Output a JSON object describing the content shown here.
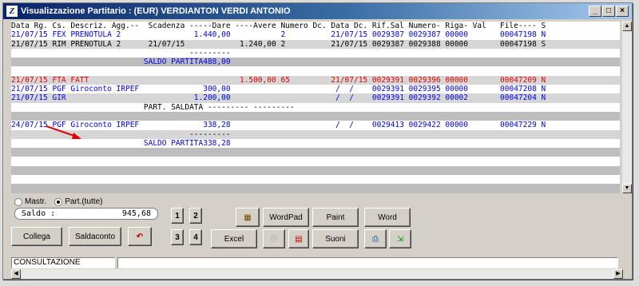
{
  "window": {
    "title": "Visualizzazione Partitario : (EUR) VERDIANTON VERDI ANTONIO",
    "app_icon": "Z",
    "minimize_label": "_",
    "maximize_label": "□",
    "close_label": "×"
  },
  "grid": {
    "header": "Data Rg. Cs. Descriz. Agg.--  Scadenza -----Dare ----Avere Numero Dc. Data Dc. Rif.Sal Numero- Riga- Val   File---- S",
    "rows": [
      {
        "style": "blue",
        "bg": "white",
        "date": "21/07/15",
        "cs": "FEX",
        "descr": "PRENOTULA 2",
        "scad": "",
        "dare": "1.440,00",
        "avere": "",
        "num": "2",
        "datadc": "21/07/15",
        "rifsal": "0029387",
        "numero": "0029387",
        "riga": "00000",
        "file": "00047198",
        "s": "N"
      },
      {
        "style": "black",
        "bg": "gray",
        "date": "21/07/15",
        "cs": "RIM",
        "descr": "PRENOTULA 2",
        "scad": "21/07/15",
        "dare": "",
        "avere": "1.240,00",
        "num": "2",
        "datadc": "21/07/15",
        "rifsal": "0029387",
        "numero": "0029388",
        "riga": "00000",
        "file": "00047198",
        "s": "S"
      },
      {
        "kind": "sep",
        "bg": "white",
        "text": "---------"
      },
      {
        "kind": "saldo",
        "bg": "darkgray",
        "label": "SALDO PARTITA",
        "value": "488,00"
      },
      {
        "kind": "empty",
        "bg": "white"
      },
      {
        "style": "red",
        "bg": "gray",
        "date": "21/07/15",
        "cs": "FTA",
        "descr": "FATT",
        "scad": "",
        "dare": "",
        "avere": "1.500,00",
        "num": "65",
        "datadc": "21/07/15",
        "rifsal": "0029391",
        "numero": "0029396",
        "riga": "00000",
        "file": "00047209",
        "s": "N"
      },
      {
        "style": "blue",
        "bg": "white",
        "date": "21/07/15",
        "cs": "PGF",
        "descr": "Giroconto IRPEF",
        "scad": "",
        "dare": "300,00",
        "avere": "",
        "num": "",
        "datadc": "/  /",
        "rifsal": "0029391",
        "numero": "0029395",
        "riga": "00000",
        "file": "00047208",
        "s": "N"
      },
      {
        "style": "blue",
        "bg": "gray",
        "date": "21/07/15",
        "cs": "GIR",
        "descr": "",
        "scad": "",
        "dare": "1.200,00",
        "avere": "",
        "num": "",
        "datadc": "/  /",
        "rifsal": "0029391",
        "numero": "0029392",
        "riga": "00002",
        "file": "00047204",
        "s": "N"
      },
      {
        "kind": "parts",
        "bg": "white",
        "text": "PART. SALDATA --------- ---------"
      },
      {
        "kind": "empty",
        "bg": "darkgray"
      },
      {
        "style": "blue",
        "bg": "white",
        "date": "24/07/15",
        "cs": "PGF",
        "descr": "Giroconto IRPEF",
        "scad": "",
        "dare": "338,28",
        "avere": "",
        "num": "",
        "datadc": "/  /",
        "rifsal": "0029413",
        "numero": "0029422",
        "riga": "00000",
        "file": "00047229",
        "s": "N"
      },
      {
        "kind": "sep",
        "bg": "gray",
        "text": "---------"
      },
      {
        "kind": "saldo",
        "bg": "white",
        "label": "SALDO PARTITA",
        "value": "338,28"
      },
      {
        "kind": "empty",
        "bg": "darkgray"
      },
      {
        "kind": "empty",
        "bg": "white"
      },
      {
        "kind": "empty",
        "bg": "darkgray"
      },
      {
        "kind": "empty",
        "bg": "white"
      },
      {
        "kind": "empty",
        "bg": "darkgray"
      }
    ]
  },
  "filters": {
    "mastr_label": "Mastr.",
    "part_label": "Part.(tutte)",
    "selected": "part"
  },
  "saldo": {
    "label": "Saldo :",
    "value": "945,68"
  },
  "buttons": {
    "collega": "Collega",
    "saldaconto": "Saldaconto",
    "wordpad": "WordPad",
    "paint": "Paint",
    "word": "Word",
    "excel": "Excel",
    "suoni": "Suoni",
    "n1": "1",
    "n2": "2",
    "n3": "3",
    "n4": "4"
  },
  "status": {
    "mode": "CONSULTAZIONE",
    "message": ""
  },
  "colors": {
    "accent_title": "#0a246a",
    "blue_text": "#0000ee",
    "red_text": "#e00000",
    "row_gray": "#d6d6d6"
  }
}
